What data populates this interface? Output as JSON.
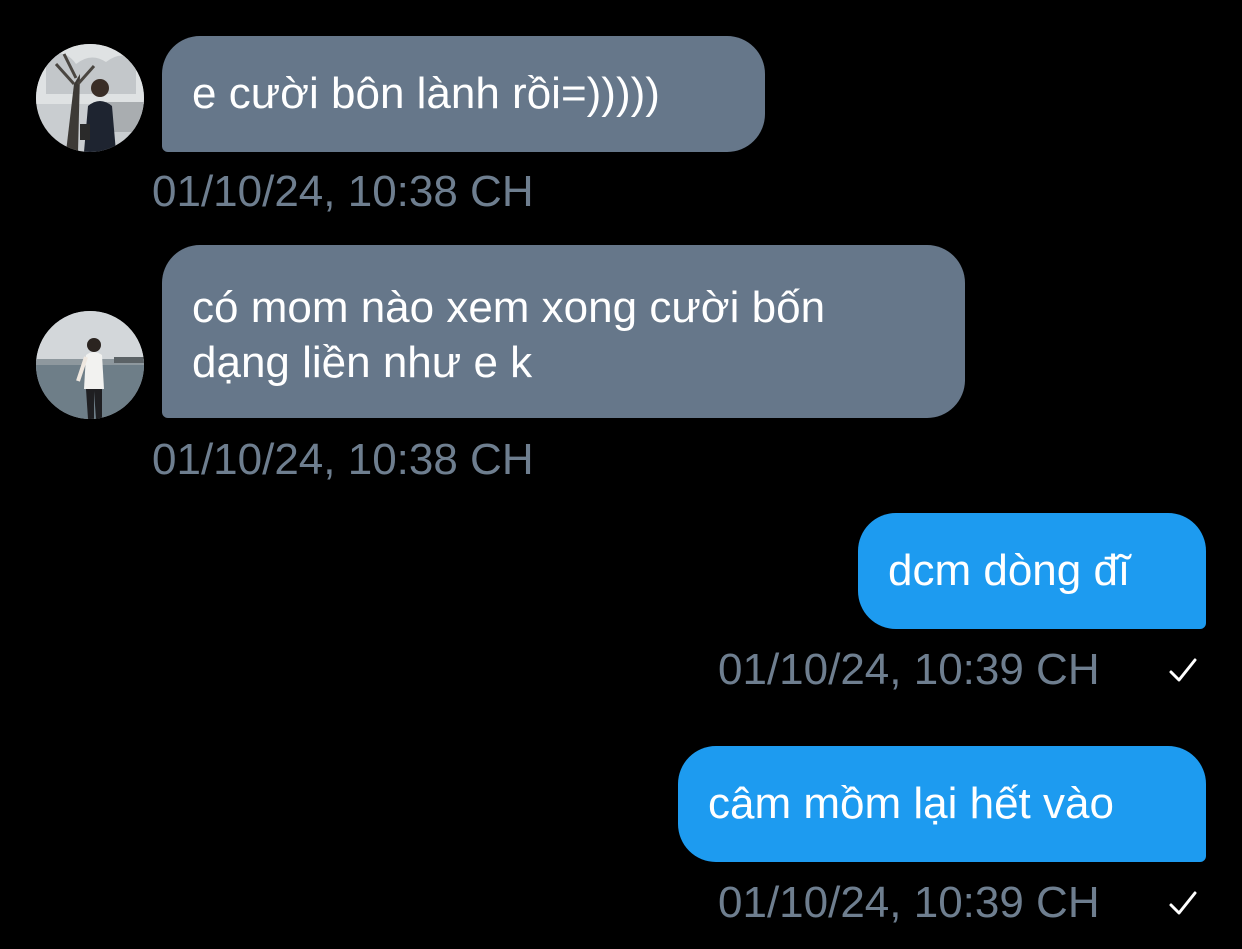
{
  "colors": {
    "background": "#000000",
    "incoming_bubble": "#66778a",
    "outgoing_bubble": "#1d9bf0",
    "timestamp": "#6e7e8f",
    "text": "#ffffff"
  },
  "messages": [
    {
      "direction": "incoming",
      "lines": [
        "e cười bôn lành rồi=)))))"
      ],
      "timestamp": "01/10/24, 10:38 CH",
      "avatar": "avatar-photo-tree"
    },
    {
      "direction": "incoming",
      "lines": [
        "có mom nào xem xong cười bốn",
        "dạng liền như e k"
      ],
      "timestamp": "01/10/24, 10:38 CH",
      "avatar": "avatar-photo-sea"
    },
    {
      "direction": "outgoing",
      "lines": [
        "dcm dòng đĩ"
      ],
      "timestamp": "01/10/24, 10:39 CH",
      "status_icon": "check-icon"
    },
    {
      "direction": "outgoing",
      "lines": [
        "câm mồm lại hết vào"
      ],
      "timestamp": "01/10/24, 10:39 CH",
      "status_icon": "check-icon"
    }
  ]
}
